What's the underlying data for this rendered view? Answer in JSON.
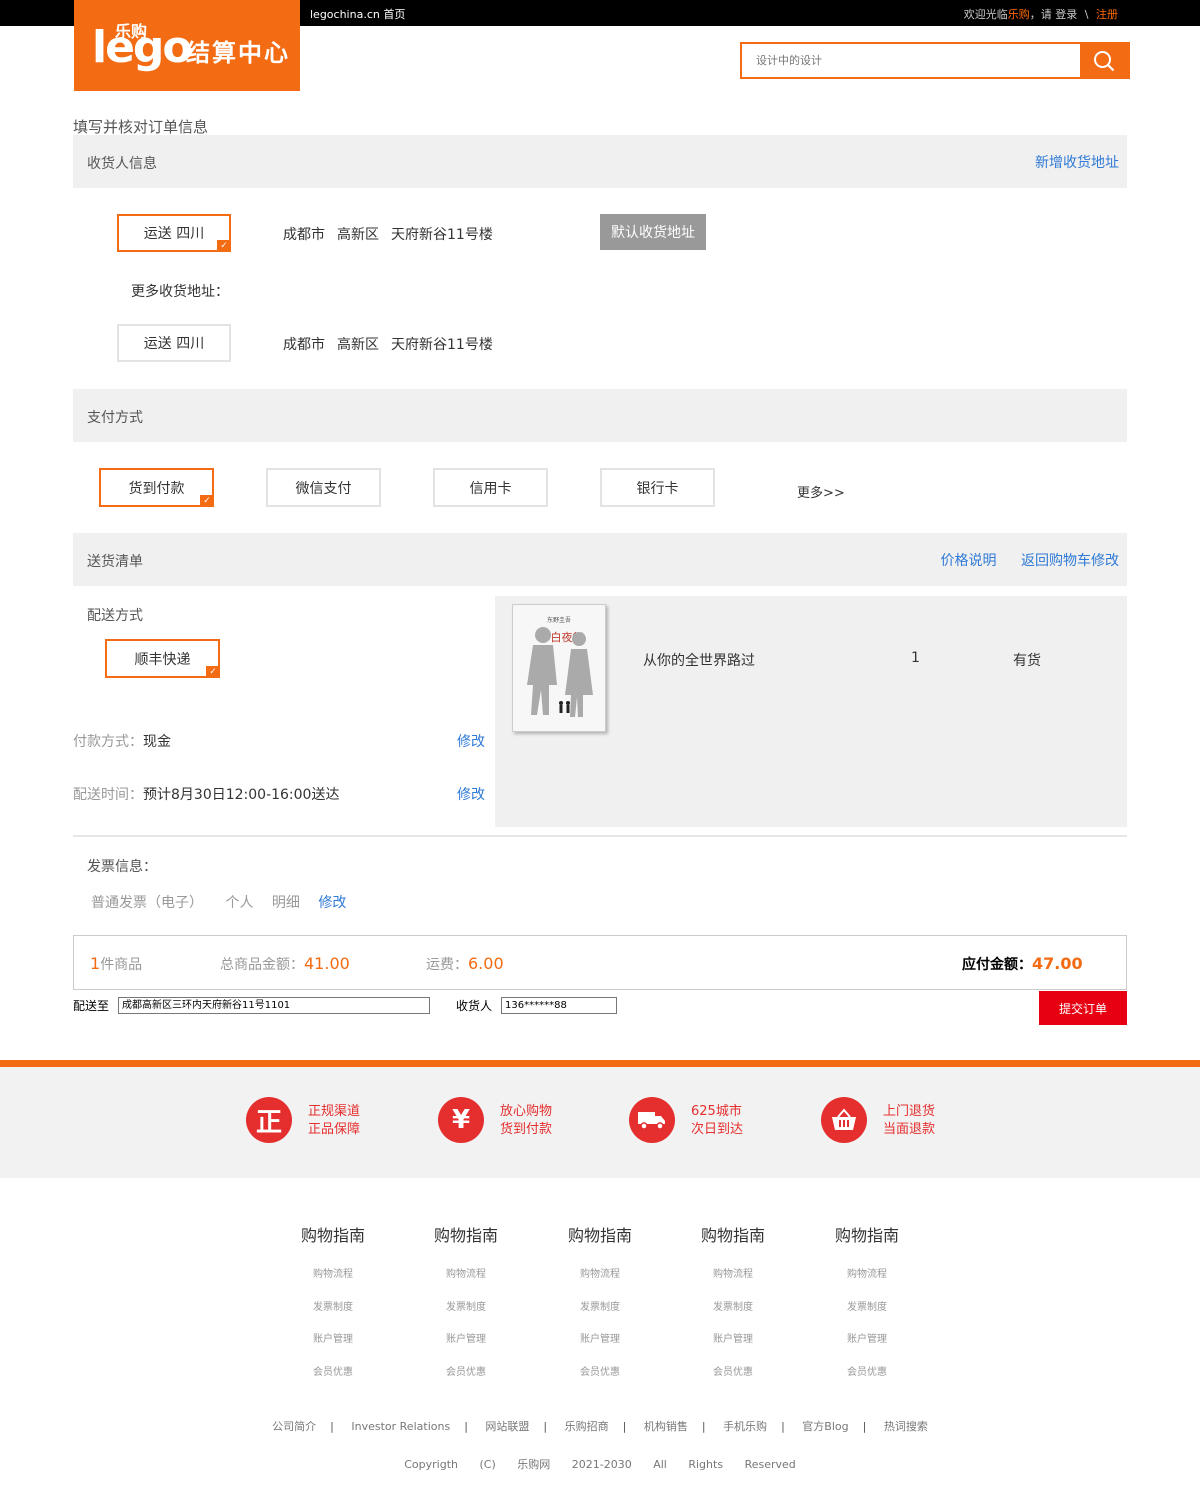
{
  "topbar": {
    "home_link": "legochina.cn 首页",
    "welcome": "欢迎光临",
    "brand": "乐购",
    "please": "，请",
    "login": "登录",
    "sep": "\\",
    "register": "注册"
  },
  "logo": {
    "small": "乐购",
    "big": "lego",
    "center": "结算中心"
  },
  "search": {
    "placeholder": "设计中的设计",
    "icon": "search-icon"
  },
  "page_title": "填写并核对订单信息",
  "receiver": {
    "title": "收货人信息",
    "add_link": "新增收货地址",
    "selected": {
      "label": "运送 四川",
      "city": "成都市",
      "district": "高新区",
      "street": "天府新谷11号楼",
      "default_btn": "默认收货地址"
    },
    "more_label": "更多收货地址：",
    "other": {
      "label": "运送 四川",
      "city": "成都市",
      "district": "高新区",
      "street": "天府新谷11号楼"
    }
  },
  "payment": {
    "title": "支付方式",
    "options": [
      "货到付款",
      "微信支付",
      "信用卡",
      "银行卡"
    ],
    "selected_index": 0,
    "more": "更多>>"
  },
  "delivery": {
    "title": "送货清单",
    "links": [
      "价格说明",
      "返回购物车修改"
    ],
    "method_label": "配送方式",
    "method": "顺丰快递",
    "pay_label": "付款方式：",
    "pay_value": "现金",
    "time_label": "配送时间：",
    "time_value": "预计8月30日12:00-16:00送达",
    "edit": "修改",
    "product": {
      "name": "从你的全世界路过",
      "qty": "1",
      "stock": "有货",
      "cover_title": "白夜行",
      "cover_author": "东野圭吾"
    }
  },
  "invoice": {
    "title": "发票信息：",
    "type": "普通发票（电子）",
    "person": "个人",
    "detail": "明细",
    "edit": "修改"
  },
  "summary": {
    "count": "1",
    "count_unit": "件商品",
    "total_label": "总商品金额：",
    "total": "41.00",
    "ship_label": "运费：",
    "ship": "6.00",
    "pay_label": "应付金额：",
    "pay": "47.00"
  },
  "ship_to": {
    "label": "配送至",
    "address": "成都高新区三环内天府新谷11号1101",
    "receiver_label": "收货人",
    "phone": "136******88",
    "submit": "提交订单"
  },
  "features": [
    {
      "icon": "正",
      "line1": "正规渠道",
      "line2": "正品保障"
    },
    {
      "icon": "¥",
      "line1": "放心购物",
      "line2": "货到付款"
    },
    {
      "icon": "truck-icon",
      "line1": "625城市",
      "line2": "次日到达"
    },
    {
      "icon": "basket-icon",
      "line1": "上门退货",
      "line2": "当面退款"
    }
  ],
  "help": {
    "title": "购物指南",
    "links": [
      "购物流程",
      "发票制度",
      "账户管理",
      "会员优惠"
    ]
  },
  "footer_links": [
    "公司简介",
    "Investor Relations",
    "网站联盟",
    "乐购招商",
    "机构销售",
    "手机乐购",
    "官方Blog",
    "热词搜索"
  ],
  "copyright": [
    "Copyrigth",
    "(C)",
    "乐购网",
    "2021-2030",
    "All",
    "Rights",
    "Reserved"
  ],
  "colors": {
    "accent": "#f36b13",
    "link": "#2f7ad6",
    "submit": "#e60012",
    "feature": "#e52e2e"
  }
}
